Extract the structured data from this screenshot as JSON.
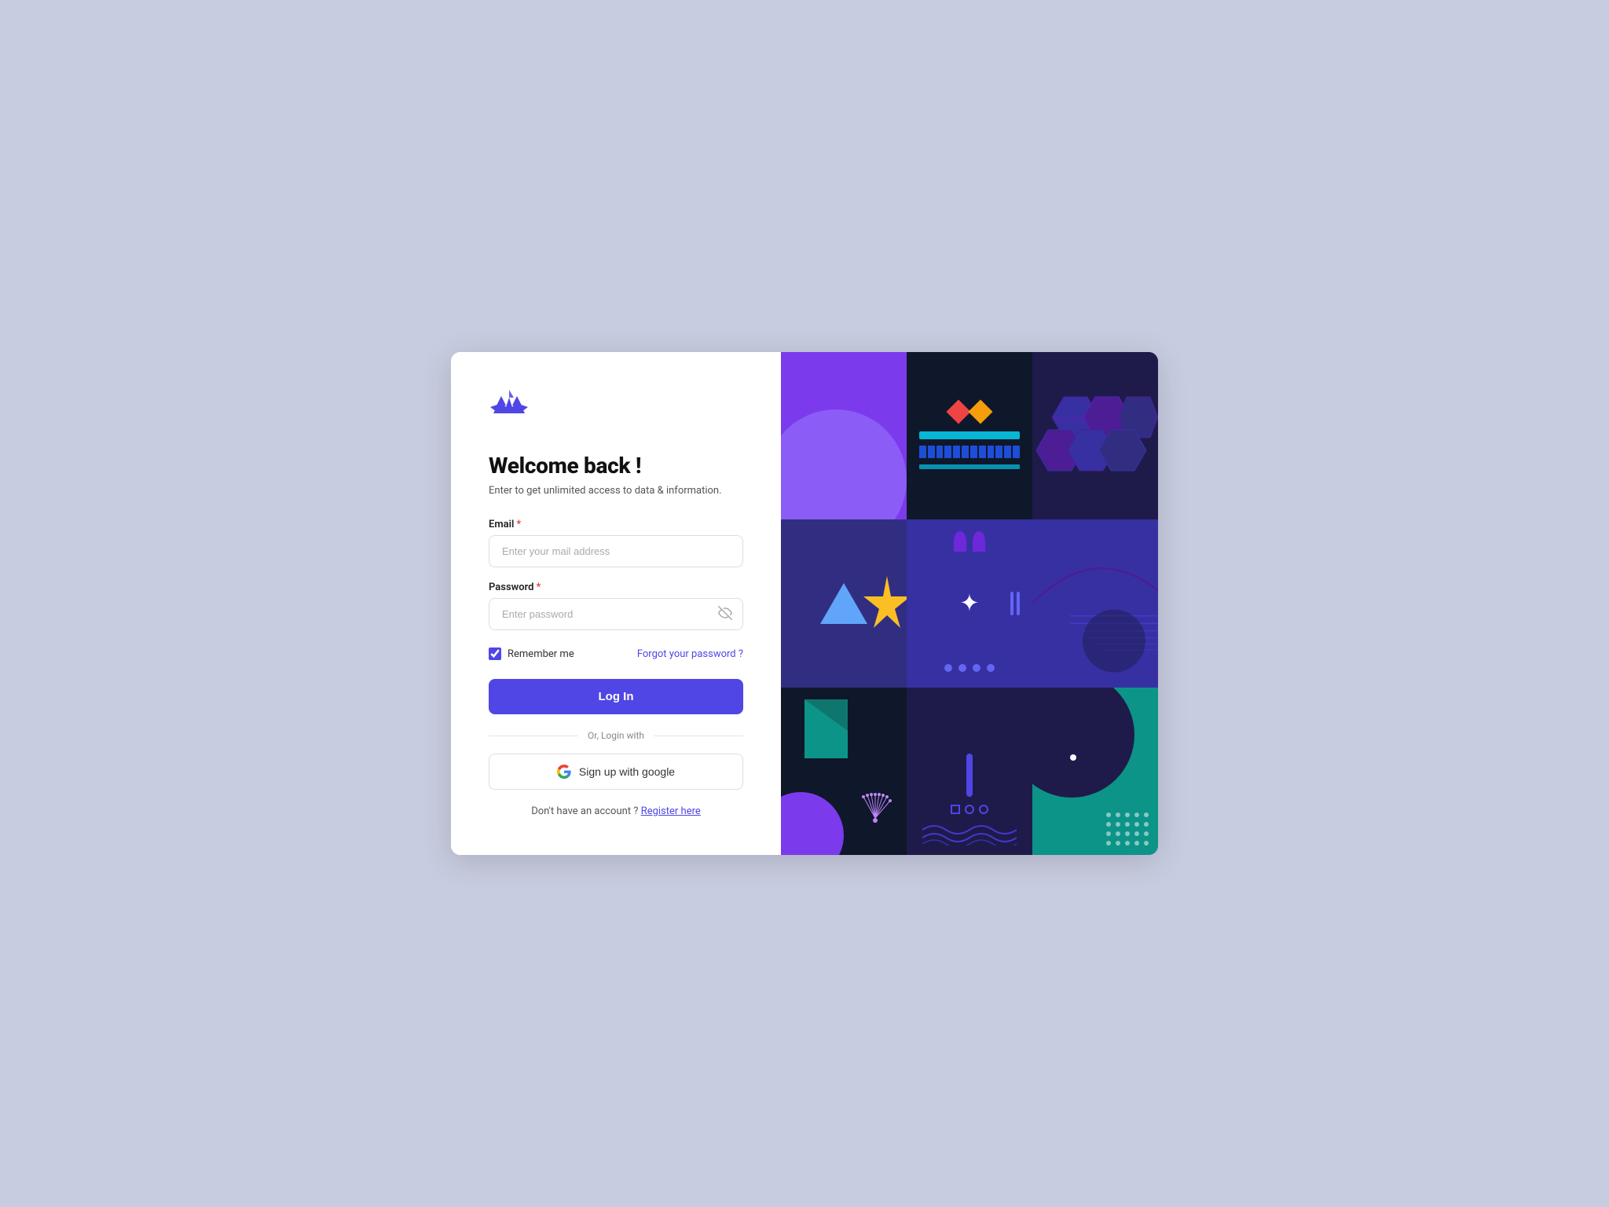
{
  "logo": {
    "alt": "Brand Logo"
  },
  "left": {
    "title": "Welcome back !",
    "subtitle": "Enter to get unlimited access to data & information.",
    "email_label": "Email",
    "email_placeholder": "Enter your mail address",
    "password_label": "Password",
    "password_placeholder": "Enter password",
    "remember_label": "Remember me",
    "forgot_label": "Forgot your password ?",
    "login_label": "Log In",
    "divider_text": "Or, Login with",
    "google_label": "Sign up with google",
    "register_text": "Don't have an account ?",
    "register_link": "Register here"
  }
}
